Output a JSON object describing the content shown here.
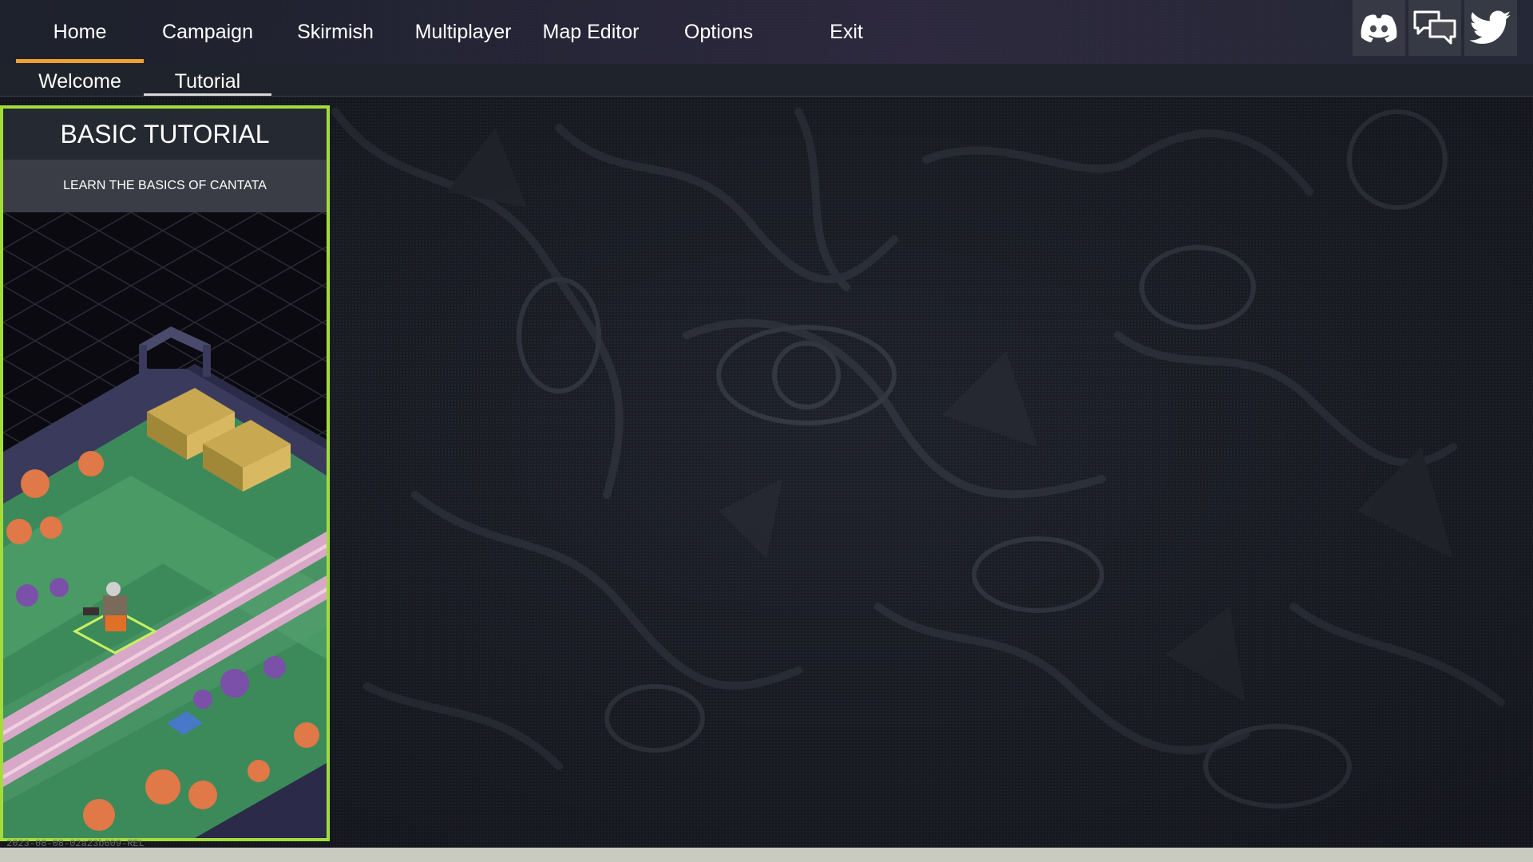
{
  "nav": {
    "tabs": [
      {
        "label": "Home"
      },
      {
        "label": "Campaign"
      },
      {
        "label": "Skirmish"
      },
      {
        "label": "Multiplayer"
      },
      {
        "label": "Map Editor"
      },
      {
        "label": "Options"
      },
      {
        "label": "Exit"
      }
    ],
    "active_tab": "Home",
    "accent_color": "#f0a030"
  },
  "social": {
    "items": [
      {
        "icon": "discord-icon"
      },
      {
        "icon": "forum-chat-icon"
      },
      {
        "icon": "twitter-icon"
      }
    ]
  },
  "subnav": {
    "tabs": [
      {
        "label": "Welcome"
      },
      {
        "label": "Tutorial"
      }
    ],
    "active_tab": "Tutorial"
  },
  "tutorial_card": {
    "title": "BASIC TUTORIAL",
    "subtitle": "LEARN THE BASICS OF CANTATA",
    "border_color": "#a4dc3a"
  },
  "footer": {
    "version": "2023-08-08-02a23b609-REL"
  }
}
